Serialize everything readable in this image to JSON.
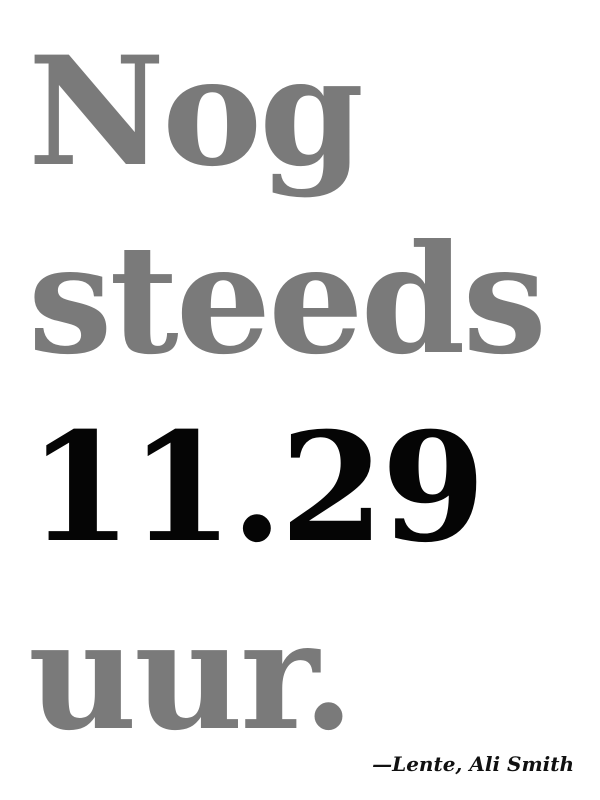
{
  "quote": {
    "lines": [
      {
        "text": "Nog",
        "color": "#7a7a7a"
      },
      {
        "text": "steeds",
        "color": "#7a7a7a"
      },
      {
        "text": "11.29",
        "color": "#050505"
      },
      {
        "text": "uur.",
        "color": "#7a7a7a"
      }
    ]
  },
  "attribution": {
    "text": "—Lente, Ali Smith"
  }
}
